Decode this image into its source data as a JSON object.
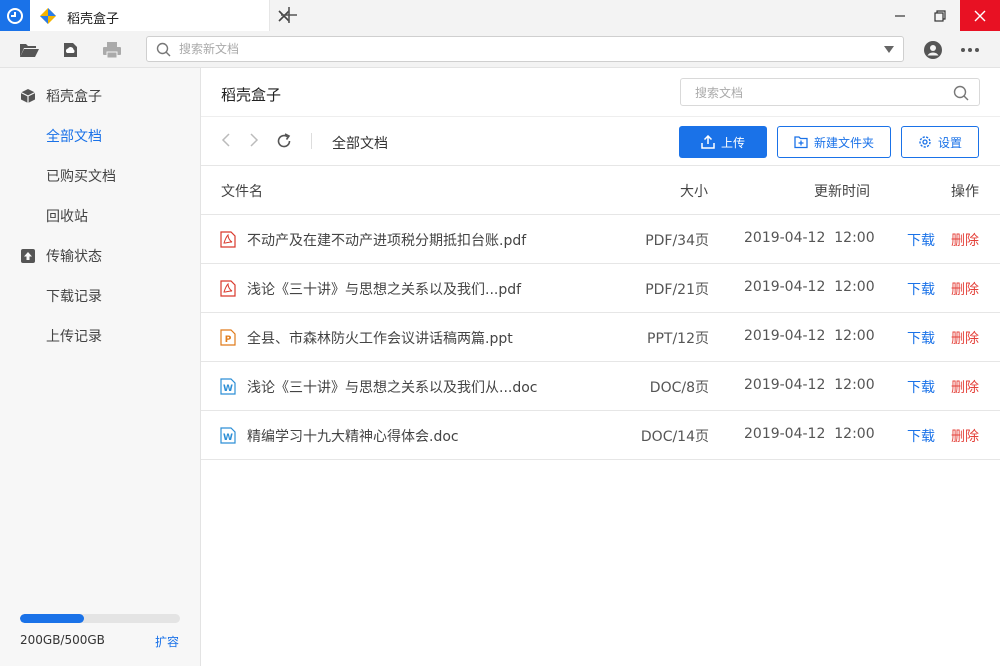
{
  "tab": {
    "title": "稻壳盒子"
  },
  "toolbar": {
    "search_placeholder": "搜索新文档"
  },
  "sidebar": {
    "items": [
      {
        "label": "稻壳盒子",
        "icon": "box-icon",
        "active": false
      },
      {
        "label": "全部文档",
        "active": true
      },
      {
        "label": "已购买文档",
        "active": false
      },
      {
        "label": "回收站",
        "active": false
      },
      {
        "label": "传输状态",
        "icon": "transfer-icon",
        "active": false
      },
      {
        "label": "下载记录",
        "active": false
      },
      {
        "label": "上传记录",
        "active": false
      }
    ],
    "storage": {
      "text": "200GB/500GB",
      "used_fraction": 0.4,
      "expand_label": "扩容"
    }
  },
  "main": {
    "title": "稻壳盒子",
    "search_placeholder": "搜索文档",
    "breadcrumb": "全部文档",
    "buttons": {
      "upload": "上传",
      "new_folder": "新建文件夹",
      "settings": "设置"
    },
    "columns": {
      "name": "文件名",
      "size": "大小",
      "time": "更新时间",
      "action": "操作"
    },
    "files": [
      {
        "name": "不动产及在建不动产进项税分期抵扣台账.pdf",
        "size": "PDF/34页",
        "time": "2019-04-12  12:00",
        "type": "pdf"
      },
      {
        "name": "浅论《三十讲》与思想之关系以及我们...pdf",
        "size": "PDF/21页",
        "time": "2019-04-12  12:00",
        "type": "pdf"
      },
      {
        "name": "全县、市森林防火工作会议讲话稿两篇.ppt",
        "size": "PPT/12页",
        "time": "2019-04-12  12:00",
        "type": "ppt"
      },
      {
        "name": "浅论《三十讲》与思想之关系以及我们从...doc",
        "size": "DOC/8页",
        "time": "2019-04-12  12:00",
        "type": "doc"
      },
      {
        "name": "精编学习十九大精神心得体会.doc",
        "size": "DOC/14页",
        "time": "2019-04-12  12:00",
        "type": "doc"
      }
    ],
    "row_actions": {
      "download": "下载",
      "delete": "删除"
    }
  },
  "colors": {
    "accent": "#1a72e8",
    "danger": "#e4413a",
    "pdf": "#d9392c",
    "ppt": "#e07b1a",
    "doc": "#2d8fd6"
  }
}
